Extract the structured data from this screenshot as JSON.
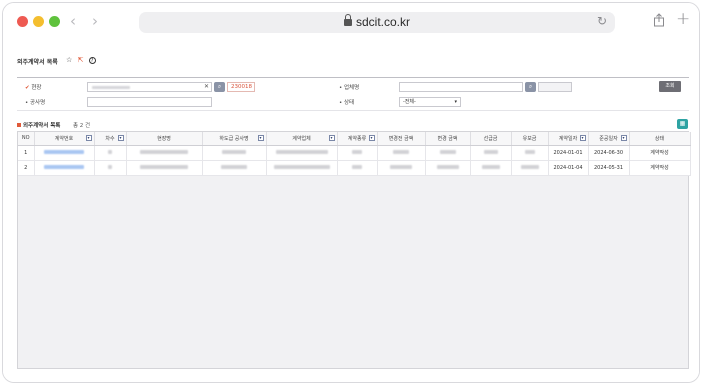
{
  "browser": {
    "url": "sdcit.co.kr"
  },
  "page": {
    "title": "외주계약서 목록"
  },
  "search": {
    "site_label": "현장",
    "site_code": "230018",
    "company_label": "업체명",
    "project_label": "공사명",
    "status_label": "상태",
    "status_value": "-전체-",
    "query_button": "조회"
  },
  "list": {
    "title": "외주계약서 목록",
    "count_text": "총 2 건",
    "columns": [
      "NO",
      "계약번호",
      "차수",
      "현장명",
      "하도급 공사명",
      "계약업체",
      "계약종류",
      "변경전 금액",
      "변경 금액",
      "선급금",
      "유보금",
      "계약일자",
      "준공일자",
      "상태"
    ],
    "rows": [
      {
        "no": "1",
        "contract_date": "2024-01-01",
        "completion_date": "2024-06-30",
        "status": "계약작성"
      },
      {
        "no": "2",
        "contract_date": "2024-01-04",
        "completion_date": "2024-05-31",
        "status": "계약작성"
      }
    ]
  },
  "icons": {
    "favorite": "star-icon",
    "external": "external-link-icon",
    "help": "help-icon",
    "excel": "excel-icon",
    "search": "search-icon"
  },
  "colors": {
    "accent": "#e05a3a",
    "query_button": "#6e6e74",
    "excel": "#2ea3a3"
  }
}
